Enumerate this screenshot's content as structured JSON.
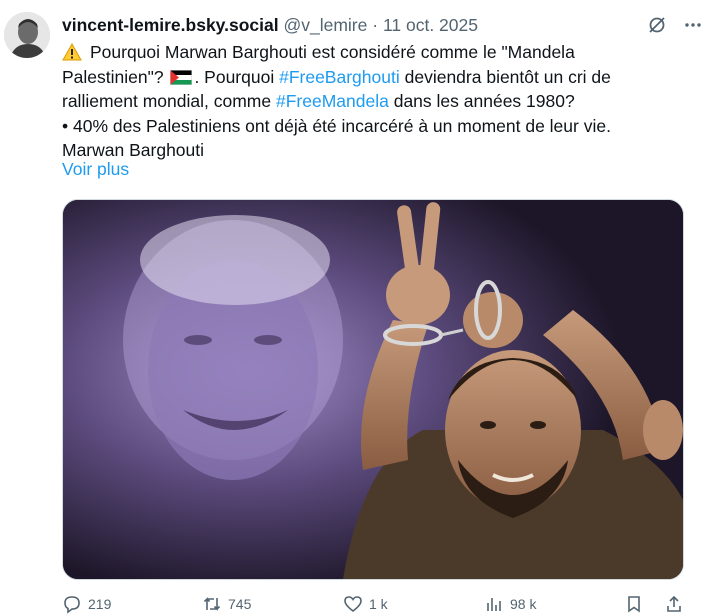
{
  "author": {
    "display_name": "vincent-lemire.bsky.social",
    "handle": "@v_lemire",
    "separator": "·",
    "date": "11 oct. 2025",
    "avatar_icon": "avatar-photo"
  },
  "top_icons": [
    "grok-icon",
    "more-icon"
  ],
  "tweet": {
    "line1": "Pourquoi Marwan Barghouti est considéré comme le \"Mandela",
    "line2_a": "Palestinien\"?",
    "line2_b": ". Pourquoi",
    "hashtag1": "#FreeBarghouti",
    "line2_c": "deviendra bientôt un cri de",
    "line3_a": "ralliement mondial, comme",
    "hashtag2": "#FreeMandela",
    "line3_b": "dans les années 1980?",
    "line4": "• 40% des Palestiniens ont déjà été incarcéré à un moment de leur vie.",
    "line5": "Marwan Barghouti",
    "show_more": "Voir plus"
  },
  "colors": {
    "accent": "#1d9bf0",
    "secondary_text": "#536471",
    "primary_text": "#0f1419"
  },
  "actions": {
    "replies": "219",
    "reposts": "745",
    "likes": "1 k",
    "views": "98 k"
  }
}
